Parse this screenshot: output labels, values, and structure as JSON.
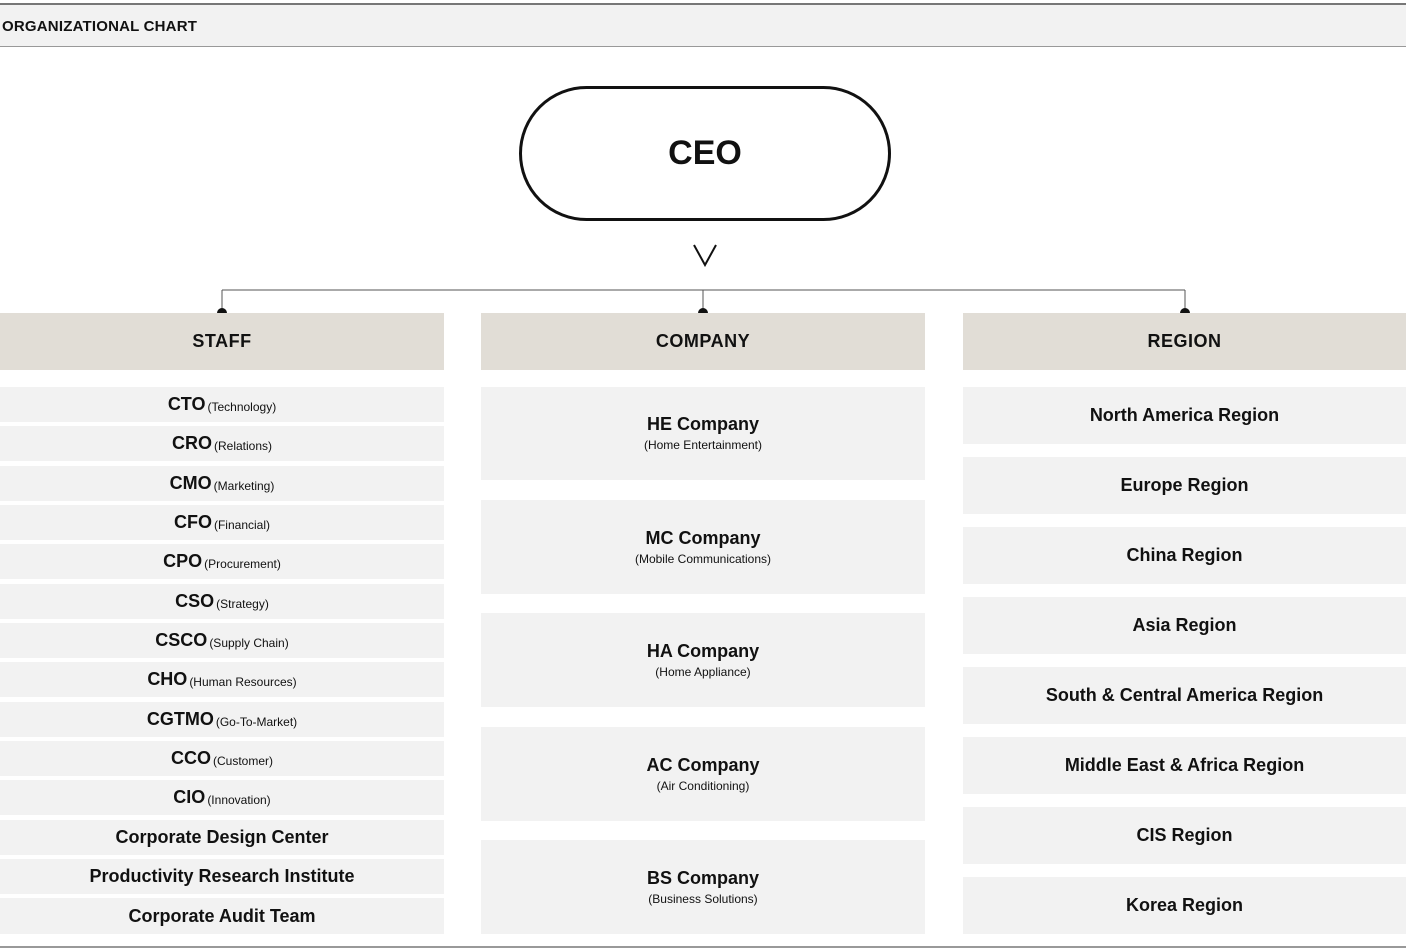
{
  "header": {
    "title": "ORGANIZATIONAL CHART"
  },
  "ceo": {
    "label": "CEO",
    "expand_icon": "chevron-down-icon"
  },
  "columns": {
    "staff": {
      "title": "STAFF"
    },
    "company": {
      "title": "COMPANY"
    },
    "region": {
      "title": "REGION"
    }
  },
  "staff": [
    {
      "code": "CTO",
      "desc": "(Technology)"
    },
    {
      "code": "CRO",
      "desc": "(Relations)"
    },
    {
      "code": "CMO",
      "desc": "(Marketing)"
    },
    {
      "code": "CFO",
      "desc": "(Financial)"
    },
    {
      "code": "CPO",
      "desc": "(Procurement)"
    },
    {
      "code": "CSO",
      "desc": "(Strategy)"
    },
    {
      "code": "CSCO",
      "desc": "(Supply Chain)"
    },
    {
      "code": "CHO",
      "desc": "(Human Resources)"
    },
    {
      "code": "CGTMO",
      "desc": "(Go-To-Market)"
    },
    {
      "code": "CCO",
      "desc": "(Customer)"
    },
    {
      "code": "CIO",
      "desc": "(Innovation)"
    },
    {
      "name": "Corporate Design Center"
    },
    {
      "name": "Productivity Research Institute"
    },
    {
      "name": "Corporate Audit Team"
    }
  ],
  "companies": [
    {
      "name": "HE Company",
      "desc": "(Home Entertainment)"
    },
    {
      "name": "MC Company",
      "desc": "(Mobile Communications)"
    },
    {
      "name": "HA Company",
      "desc": "(Home Appliance)"
    },
    {
      "name": "AC Company",
      "desc": "(Air Conditioning)"
    },
    {
      "name": "BS Company",
      "desc": "(Business Solutions)"
    }
  ],
  "regions": [
    {
      "name": "North America Region"
    },
    {
      "name": "Europe Region"
    },
    {
      "name": "China Region"
    },
    {
      "name": "Asia Region"
    },
    {
      "name": "South & Central America Region"
    },
    {
      "name": "Middle East & Africa Region"
    },
    {
      "name": "CIS Region"
    },
    {
      "name": "Korea Region"
    }
  ],
  "colors": {
    "header_bg": "#f2f2f2",
    "column_header_bg": "#e1ddd6",
    "cell_bg": "#f2f2f2",
    "line": "#555555",
    "text": "#111111"
  }
}
